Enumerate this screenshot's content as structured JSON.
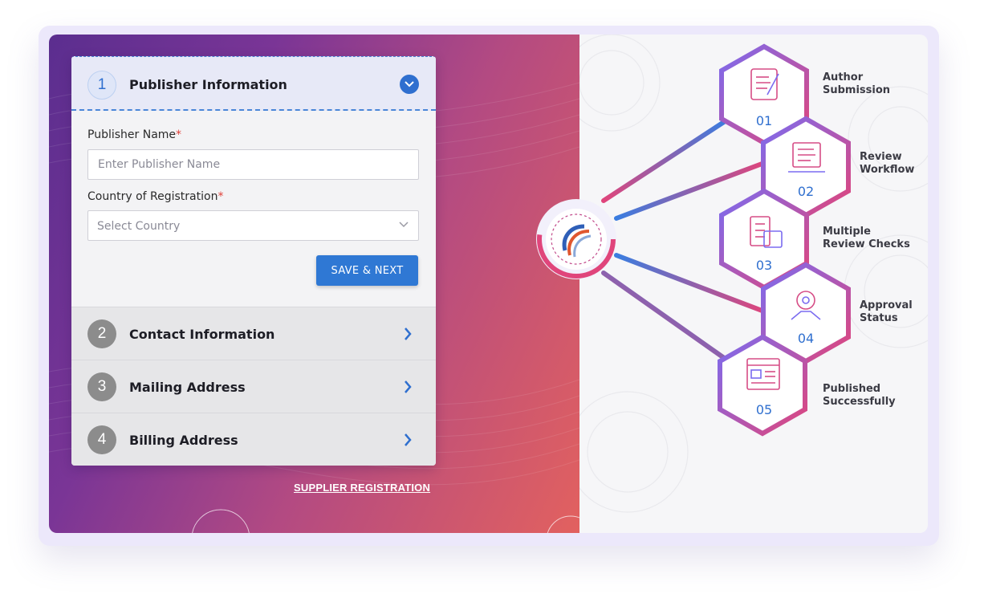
{
  "form": {
    "active_step": {
      "number": "1",
      "title": "Publisher Information",
      "fields": {
        "publisher_name_label": "Publisher Name",
        "publisher_name_placeholder": "Enter Publisher Name",
        "country_label": "Country of Registration",
        "country_placeholder": "Select Country",
        "required_mark": "*"
      },
      "save_label": "SAVE & NEXT"
    },
    "steps": [
      {
        "number": "2",
        "title": "Contact Information"
      },
      {
        "number": "3",
        "title": "Mailing Address"
      },
      {
        "number": "4",
        "title": "Billing Address"
      }
    ]
  },
  "supplier_link": "SUPPLIER REGISTRATION",
  "workflow": {
    "steps": [
      {
        "number": "01",
        "label_line1": "Author",
        "label_line2": "Submission",
        "icon": "manuscript-icon"
      },
      {
        "number": "02",
        "label_line1": "Review",
        "label_line2": "Workflow",
        "icon": "laptop-review-icon"
      },
      {
        "number": "03",
        "label_line1": "Multiple",
        "label_line2": "Review Checks",
        "icon": "checklist-calendar-icon"
      },
      {
        "number": "04",
        "label_line1": "Approval",
        "label_line2": "Status",
        "icon": "handshake-gear-icon"
      },
      {
        "number": "05",
        "label_line1": "Published",
        "label_line2": "Successfully",
        "icon": "browser-window-icon"
      }
    ]
  },
  "colors": {
    "accent_blue": "#2f6fcf",
    "hex_pink": "#e0457b",
    "hex_violet": "#7b6cf0",
    "panel_gradient_start": "#5b2e8f",
    "panel_gradient_end": "#e2615f"
  }
}
